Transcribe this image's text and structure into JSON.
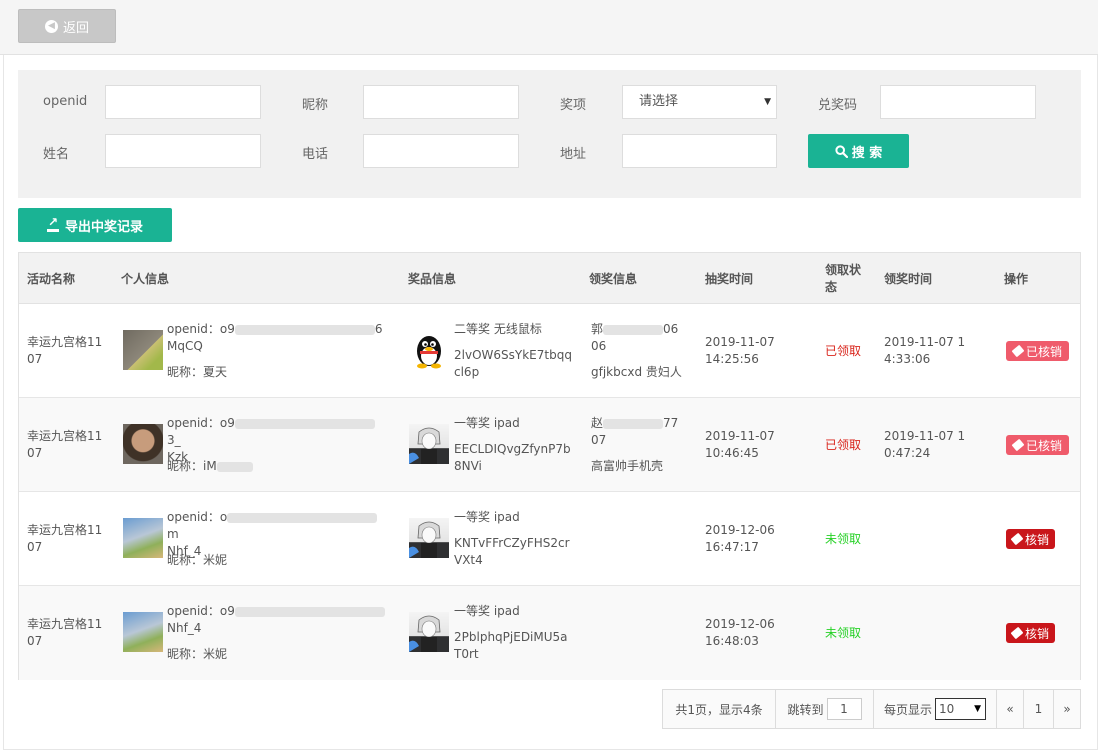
{
  "topbar": {
    "back_label": "返回"
  },
  "filters": {
    "openid_label": "openid",
    "nickname_label": "昵称",
    "prize_label": "奖项",
    "prize_select_value": "请选择",
    "code_label": "兑奖码",
    "name_label": "姓名",
    "phone_label": "电话",
    "address_label": "地址",
    "search_label": "搜 索"
  },
  "toolbar": {
    "export_label": "导出中奖记录"
  },
  "table": {
    "headers": [
      "活动名称",
      "个人信息",
      "奖品信息",
      "领奖信息",
      "抽奖时间",
      "领取状态",
      "领奖时间",
      "操作"
    ],
    "rows": [
      {
        "activity": "幸运九宫格1107",
        "openid_prefix": "openid：o9",
        "openid_suffix": "6",
        "openid_line2": "MqCQ",
        "nickname": "昵称：夏天",
        "prize": "二等奖  无线鼠标",
        "code": "2lvOW6SsYkE7tbqqcl6p",
        "claim_name": "郭",
        "claim_phone_suffix": "06",
        "claim_line2": "06",
        "claim_address": "gfjkbcxd 贵妇人",
        "draw_time": "2019-11-07 14:25:56",
        "status": "已领取",
        "claim_time": "2019-11-07 14:33:06",
        "action": "已核销"
      },
      {
        "activity": "幸运九宫格1107",
        "openid_prefix": "openid：o9",
        "openid_suffix": "3_",
        "openid_line2": "Kzk",
        "nickname": "昵称：iM",
        "prize": "一等奖  ipad",
        "code": "EECLDIQvgZfynP7b8NVi",
        "claim_name": "赵",
        "claim_phone_suffix": "77",
        "claim_line2": "07",
        "claim_address": "高富帅手机壳",
        "draw_time": "2019-11-07 10:46:45",
        "status": "已领取",
        "claim_time": "2019-11-07 10:47:24",
        "action": "已核销"
      },
      {
        "activity": "幸运九宫格1107",
        "openid_prefix": "openid：o",
        "openid_suffix": "m",
        "openid_line2": "Nhf_4",
        "nickname": "昵称：米妮",
        "prize": "一等奖  ipad",
        "code": "KNTvFFrCZyFHS2crVXt4",
        "draw_time": "2019-12-06 16:47:17",
        "status": "未领取",
        "action": "核销"
      },
      {
        "activity": "幸运九宫格1107",
        "openid_prefix": "openid：o9",
        "openid_suffix": "",
        "openid_line2": "Nhf_4",
        "nickname": "昵称：米妮",
        "prize": "一等奖  ipad",
        "code": "2PblphqPjEDiMU5aT0rt",
        "draw_time": "2019-12-06 16:48:03",
        "status": "未领取",
        "action": "核销"
      }
    ]
  },
  "pagination": {
    "summary": "共1页，显示4条",
    "jump_label": "跳转到",
    "jump_value": "1",
    "per_page_label": "每页显示",
    "per_page_value": "10",
    "prev": "«",
    "current": "1",
    "next": "»"
  }
}
